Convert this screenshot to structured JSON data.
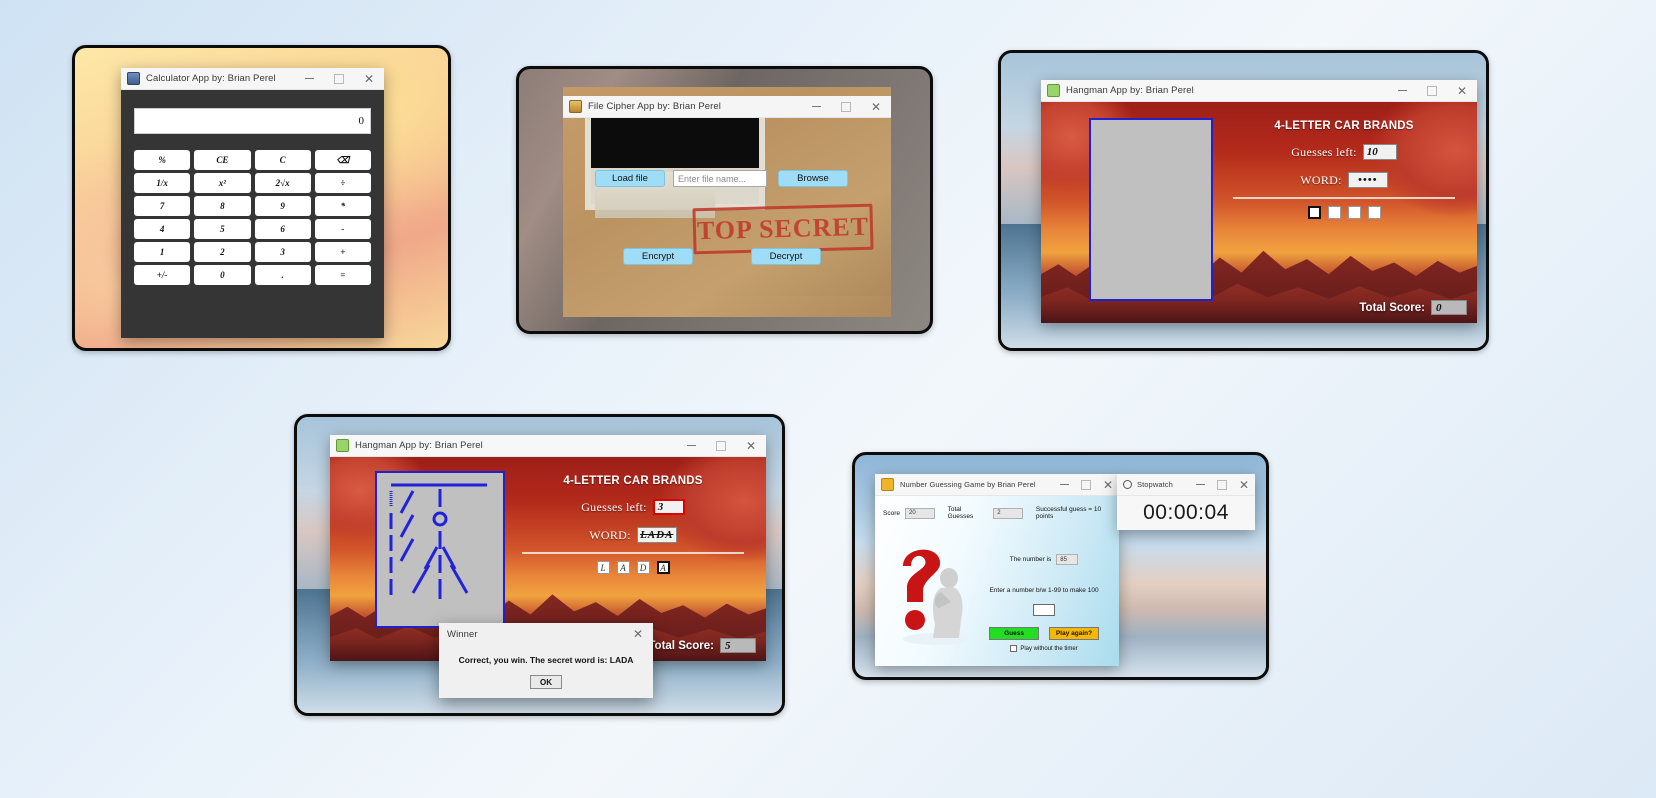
{
  "desktop": {
    "background": "#dfeaf6"
  },
  "calculator": {
    "icon": "calculator-icon",
    "title": "Calculator App by: Brian Perel",
    "display_value": "0",
    "buttons": [
      "%",
      "CE",
      "C",
      "⌫",
      "1/x",
      "x²",
      "2√x",
      "÷",
      "7",
      "8",
      "9",
      "*",
      "4",
      "5",
      "6",
      "-",
      "1",
      "2",
      "3",
      "+",
      "+/-",
      "0",
      ".",
      "="
    ],
    "window_controls": {
      "minimize": "—",
      "maximize": "□",
      "close": "✕"
    }
  },
  "file_cipher": {
    "icon": "file-cipher-icon",
    "title": "File Cipher App by: Brian Perel",
    "load_file_label": "Load file",
    "file_name_placeholder": "Enter file name...",
    "file_name_value": "",
    "browse_label": "Browse",
    "stamp_text": "TOP SECRET",
    "encrypt_label": "Encrypt",
    "decrypt_label": "Decrypt",
    "accent_button_color": "#9fdcf5",
    "stamp_color": "#c0392b"
  },
  "hangman_start": {
    "icon": "hangman-icon",
    "title": "Hangman App by: Brian Perel",
    "category": "4-LETTER CAR BRANDS",
    "guesses_label": "Guesses left:",
    "guesses_value": "10",
    "word_label": "WORD:",
    "word_value": "••••",
    "letters": [
      "",
      "",
      "",
      ""
    ],
    "selected_letter_index": 0,
    "total_score_label": "Total Score:",
    "total_score_value": "0"
  },
  "hangman_win": {
    "icon": "hangman-icon",
    "title": "Hangman App by: Brian Perel",
    "category": "4-LETTER CAR BRANDS",
    "guesses_label": "Guesses left:",
    "guesses_value": "3",
    "word_label": "WORD:",
    "word_value": "LADA",
    "letters": [
      "L",
      "A",
      "D",
      "A"
    ],
    "selected_letter_index": 3,
    "total_score_label": "Total Score:",
    "total_score_value": "5",
    "dialog": {
      "title": "Winner",
      "message": "Correct, you win. The secret word is: LADA",
      "ok_label": "OK",
      "close_icon": "close-icon"
    }
  },
  "number_guessing": {
    "icon": "number-guessing-icon",
    "title": "Number Guessing Game by Brian Perel",
    "score_label": "Score",
    "score_value": "20",
    "total_guesses_label": "Total Guesses",
    "total_guesses_value": "2",
    "points_note": "Successful guess = 10 points",
    "number_is_label": "The number is",
    "number_is_value": "85",
    "prompt": "Enter a number b/w 1-99 to make 100",
    "input_value": "",
    "guess_label": "Guess",
    "guess_color": "#22dd22",
    "play_again_label": "Play again?",
    "play_again_color": "#f5b800",
    "checkbox_label": "Play without the timer",
    "checkbox_checked": false
  },
  "stopwatch": {
    "icon": "stopwatch-icon",
    "title": "Stopwatch",
    "time": "00:00:04",
    "window_controls": {
      "minimize": "—",
      "maximize": "□",
      "close": "✕"
    }
  }
}
